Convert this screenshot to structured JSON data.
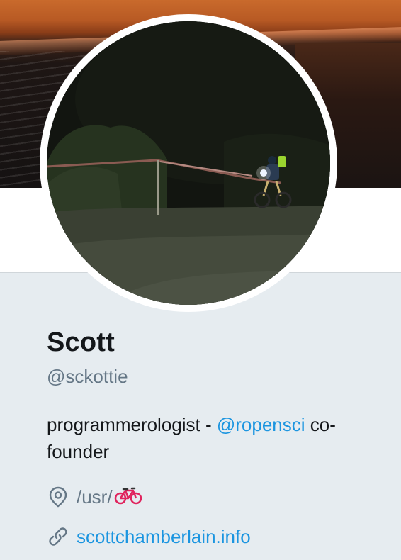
{
  "profile": {
    "name": "Scott",
    "handle": "@sckottie",
    "bio_before": "programmerologist - ",
    "bio_mention": "@ropensci",
    "bio_after": " co-founder",
    "location": "/usr/",
    "location_emoji_icon": "bicycle-icon",
    "website": "scottchamberlain.info"
  },
  "icons": {
    "location": "location-pin-icon",
    "website": "link-icon"
  },
  "colors": {
    "accent": "#1b95e0",
    "muted": "#657786",
    "text": "#14171a",
    "background": "#e6ecf0"
  }
}
